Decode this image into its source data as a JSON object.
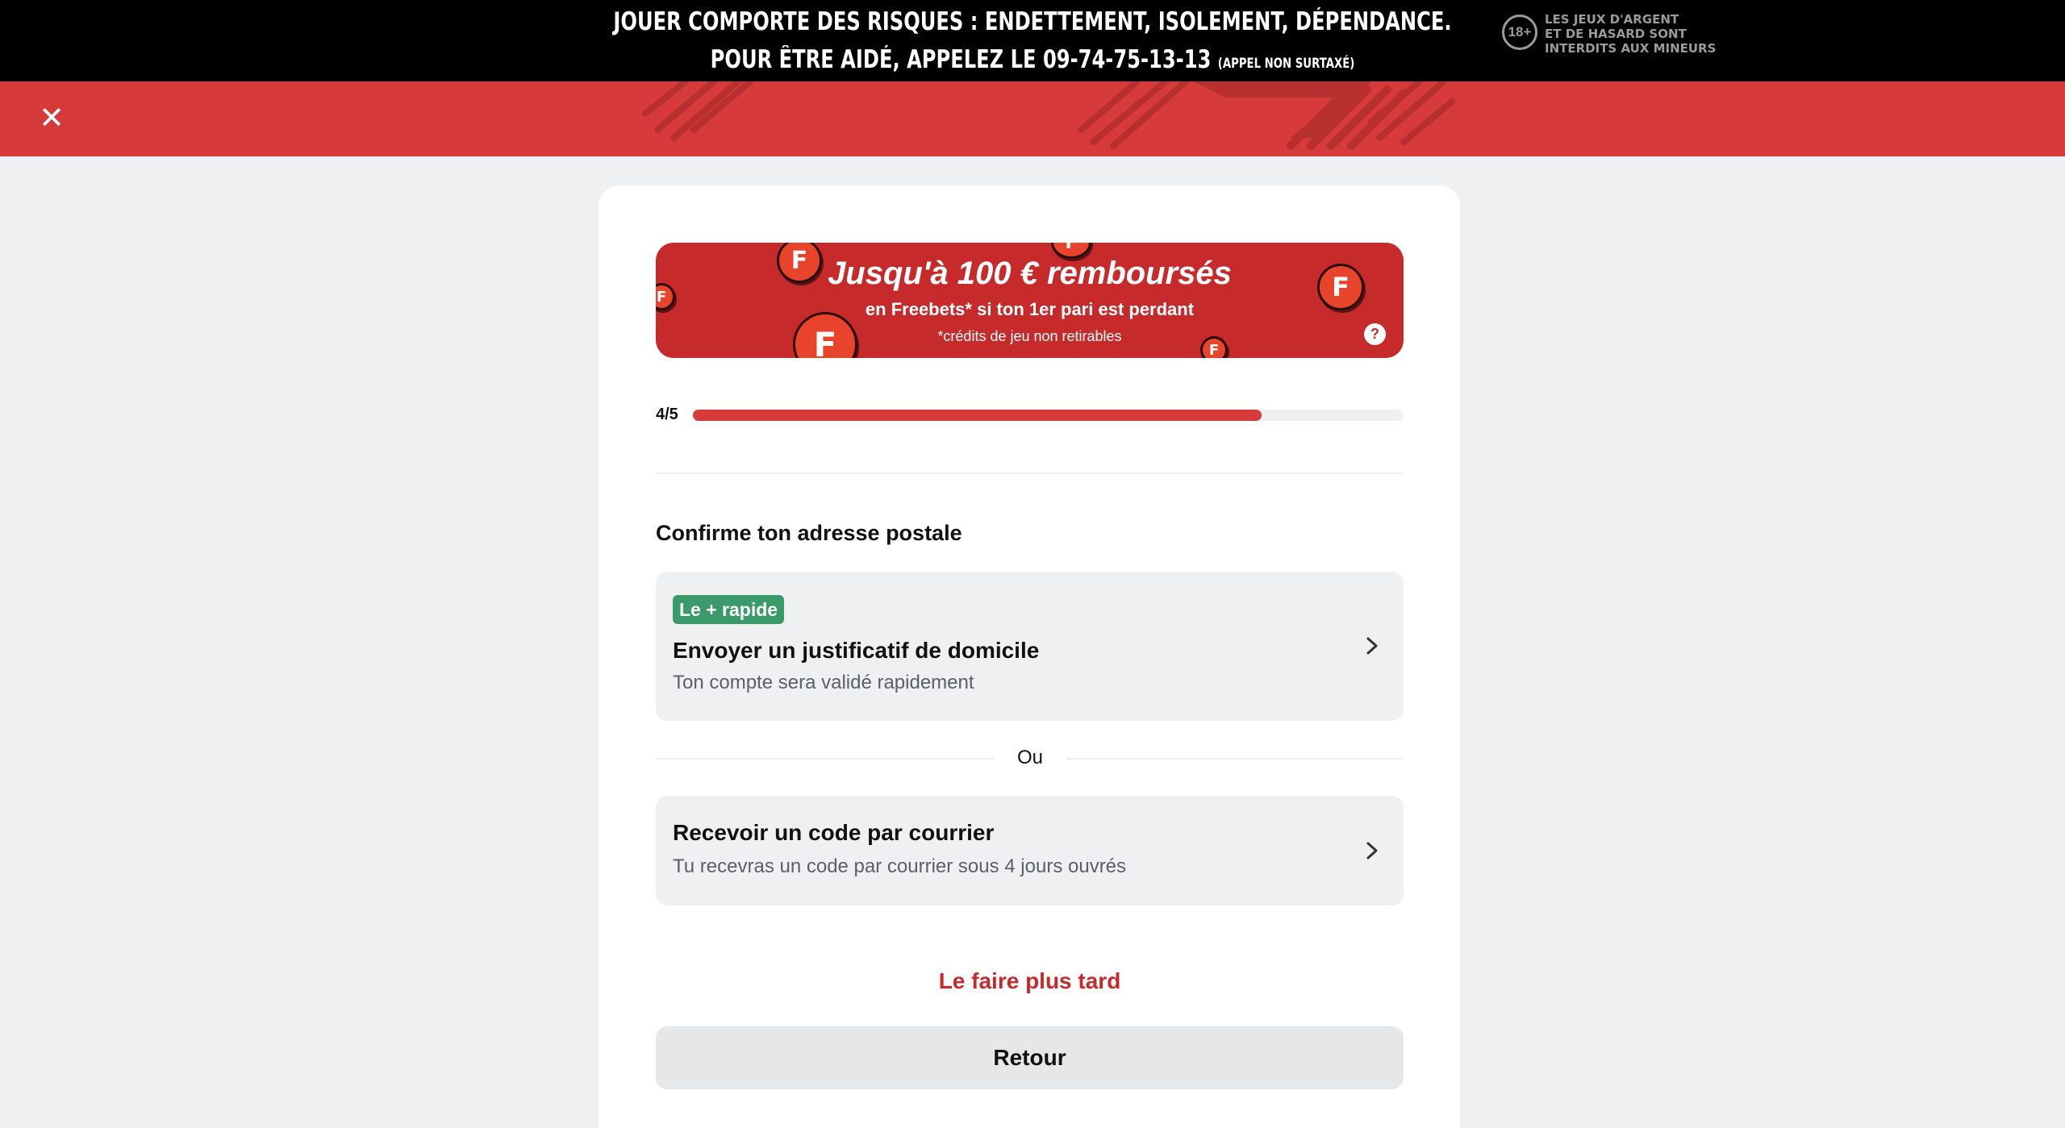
{
  "warning": {
    "line1": "JOUER COMPORTE DES RISQUES : ENDETTEMENT, ISOLEMENT, DÉPENDANCE.",
    "line2": "POUR ÊTRE AIDÉ, APPELEZ LE 09-74-75-13-13",
    "line2_small": "(APPEL NON SURTAXÉ)",
    "age_badge": "18+",
    "age_text_1": "LES JEUX D'ARGENT",
    "age_text_2": "ET DE HASARD SONT",
    "age_text_3": "INTERDITS AUX MINEURS"
  },
  "header": {
    "close_icon": "close-icon",
    "close_glyph": "✕"
  },
  "promo": {
    "title": "Jusqu'à 100 € remboursés",
    "subtitle": "en Freebets* si ton 1er pari est perdant",
    "note": "*crédits de jeu non retirables",
    "coin_letter": "F",
    "help_glyph": "?"
  },
  "progress": {
    "label": "4/5",
    "fraction": 0.8
  },
  "section": {
    "title": "Confirme ton adresse postale"
  },
  "options": [
    {
      "badge": "Le + rapide",
      "title": "Envoyer un justificatif de domicile",
      "subtitle": "Ton compte sera validé rapidement"
    },
    {
      "title": "Recevoir un code par courrier",
      "subtitle": "Tu recevras un code par courrier sous 4 jours ouvrés"
    }
  ],
  "separator": "Ou",
  "actions": {
    "later": "Le faire plus tard",
    "back": "Retour"
  },
  "colors": {
    "brand_red": "#d63a3a",
    "promo_red": "#c62a2a",
    "badge_green": "#3a9a6a"
  }
}
